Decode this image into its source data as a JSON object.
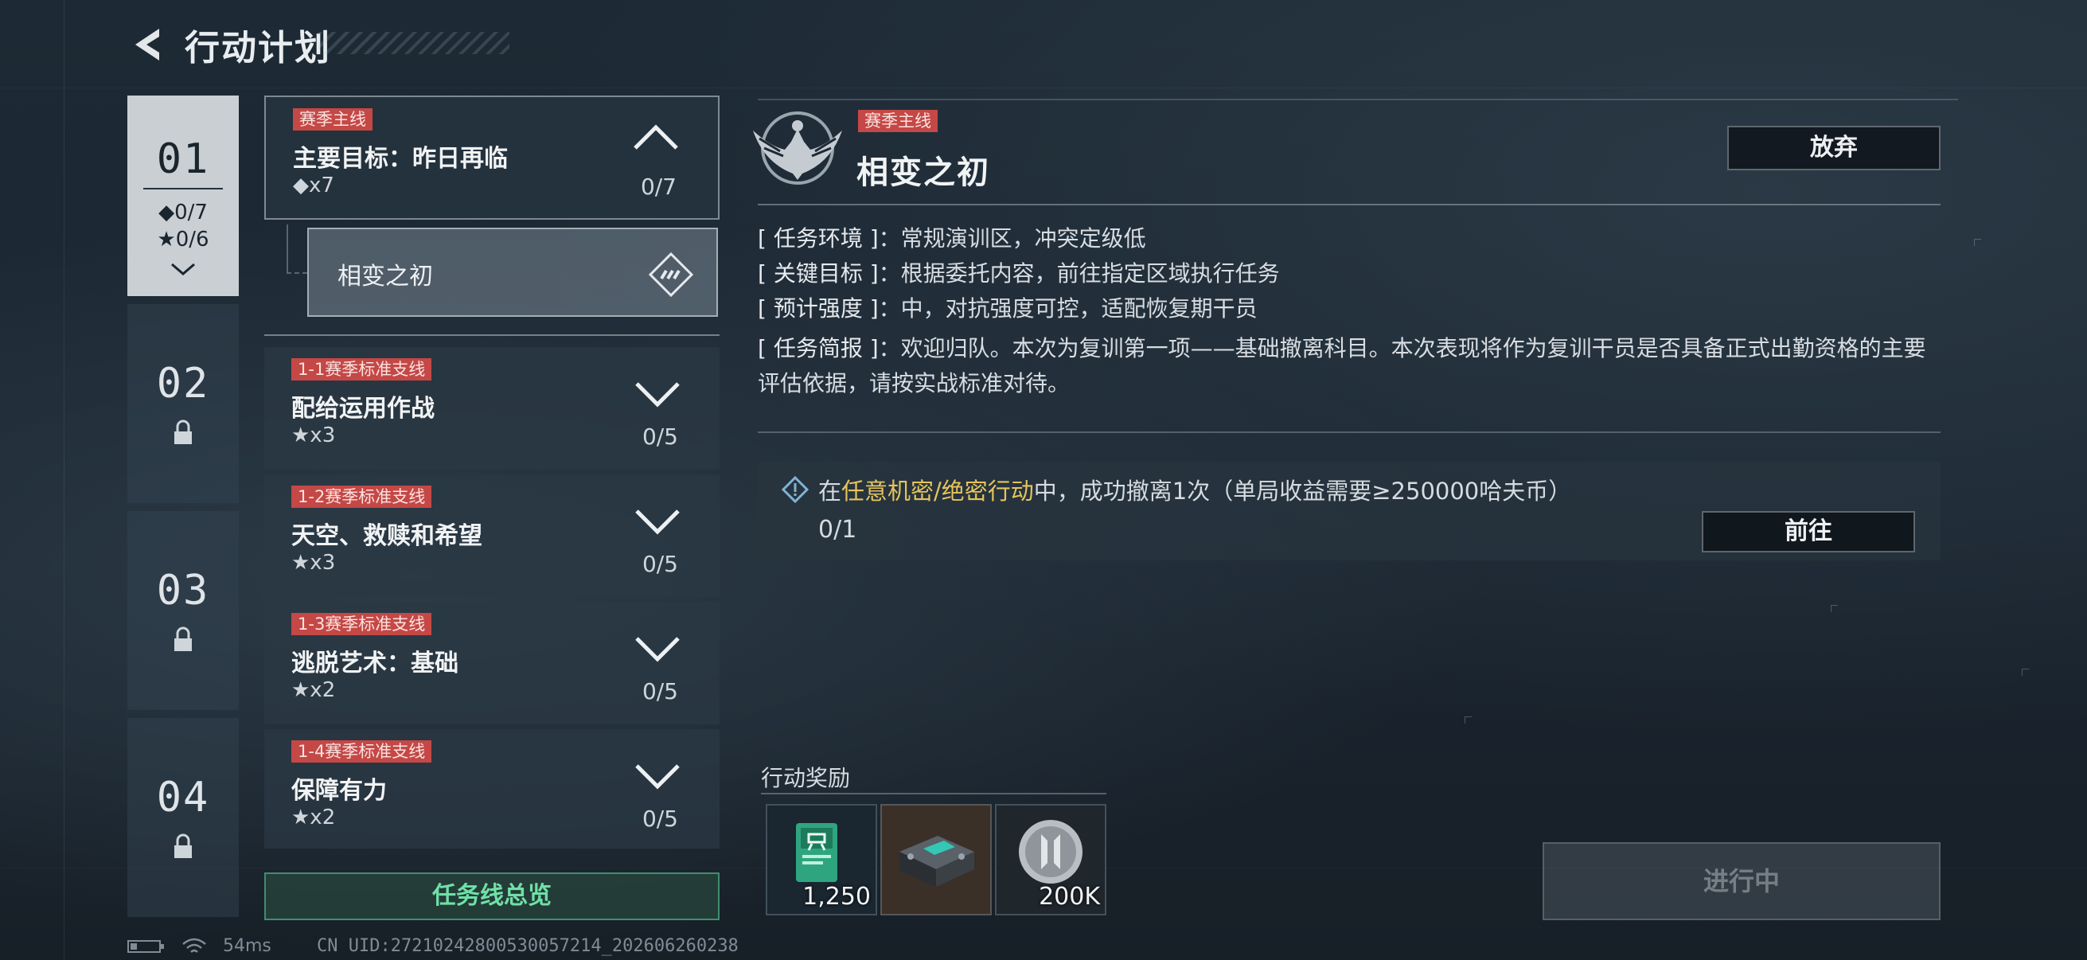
{
  "header": {
    "title": "行动计划"
  },
  "chapters": [
    {
      "num": "01",
      "diamond_count": "◆0/7",
      "star_count": "★0/6",
      "active": true
    },
    {
      "num": "02",
      "locked": true
    },
    {
      "num": "03",
      "locked": true
    },
    {
      "num": "04",
      "locked": true
    }
  ],
  "quests": [
    {
      "tag": "赛季主线",
      "title": "主要目标：昨日再临",
      "reward": "◆x7",
      "progress": "0/7",
      "expanded": true
    },
    {
      "tag": "1-1赛季标准支线",
      "title": "配给运用作战",
      "reward": "★x3",
      "progress": "0/5"
    },
    {
      "tag": "1-2赛季标准支线",
      "title": "天空、救赎和希望",
      "reward": "★x3",
      "progress": "0/5"
    },
    {
      "tag": "1-3赛季标准支线",
      "title": "逃脱艺术：基础",
      "reward": "★x2",
      "progress": "0/5"
    },
    {
      "tag": "1-4赛季标准支线",
      "title": "保障有力",
      "reward": "★x2",
      "progress": "0/5"
    }
  ],
  "sub_quest": {
    "label": "相变之初"
  },
  "overview_button": "任务线总览",
  "detail": {
    "tag": "赛季主线",
    "title": "相变之初",
    "abandon_label": "放弃",
    "info": [
      {
        "key": "[ 任务环境 ]",
        "value": "：常规演训区，冲突定级低"
      },
      {
        "key": "[ 关键目标 ]",
        "value": "：根据委托内容，前往指定区域执行任务"
      },
      {
        "key": "[ 预计强度 ]",
        "value": "：中，对抗强度可控，适配恢复期干员"
      },
      {
        "key": "[ 任务简报 ]",
        "value": "：欢迎归队。本次为复训第一项——基础撤离科目。本次表现将作为复训干员是否具备正式出勤资格的主要评估依据，请按实战标准对待。"
      }
    ],
    "objective": {
      "prefix": "在",
      "highlight": "任意机密/绝密行动",
      "suffix": "中，成功撤离1次（单局收益需要≥250000哈夫币）",
      "progress": "0/1",
      "go_label": "前往"
    },
    "rewards_label": "行动奖励",
    "rewards": [
      {
        "name": "reward-card",
        "amount": "1,250"
      },
      {
        "name": "reward-device",
        "amount": ""
      },
      {
        "name": "reward-coin",
        "amount": "200K"
      }
    ],
    "status_button": "进行中"
  },
  "status_bar": {
    "ping": "54ms",
    "uid": "CN UID:27210242800530057214_202606260238"
  },
  "colors": {
    "tag_red": "#c44846",
    "highlight_gold": "#e6c45c",
    "overview_green": "#6fe0a7"
  }
}
